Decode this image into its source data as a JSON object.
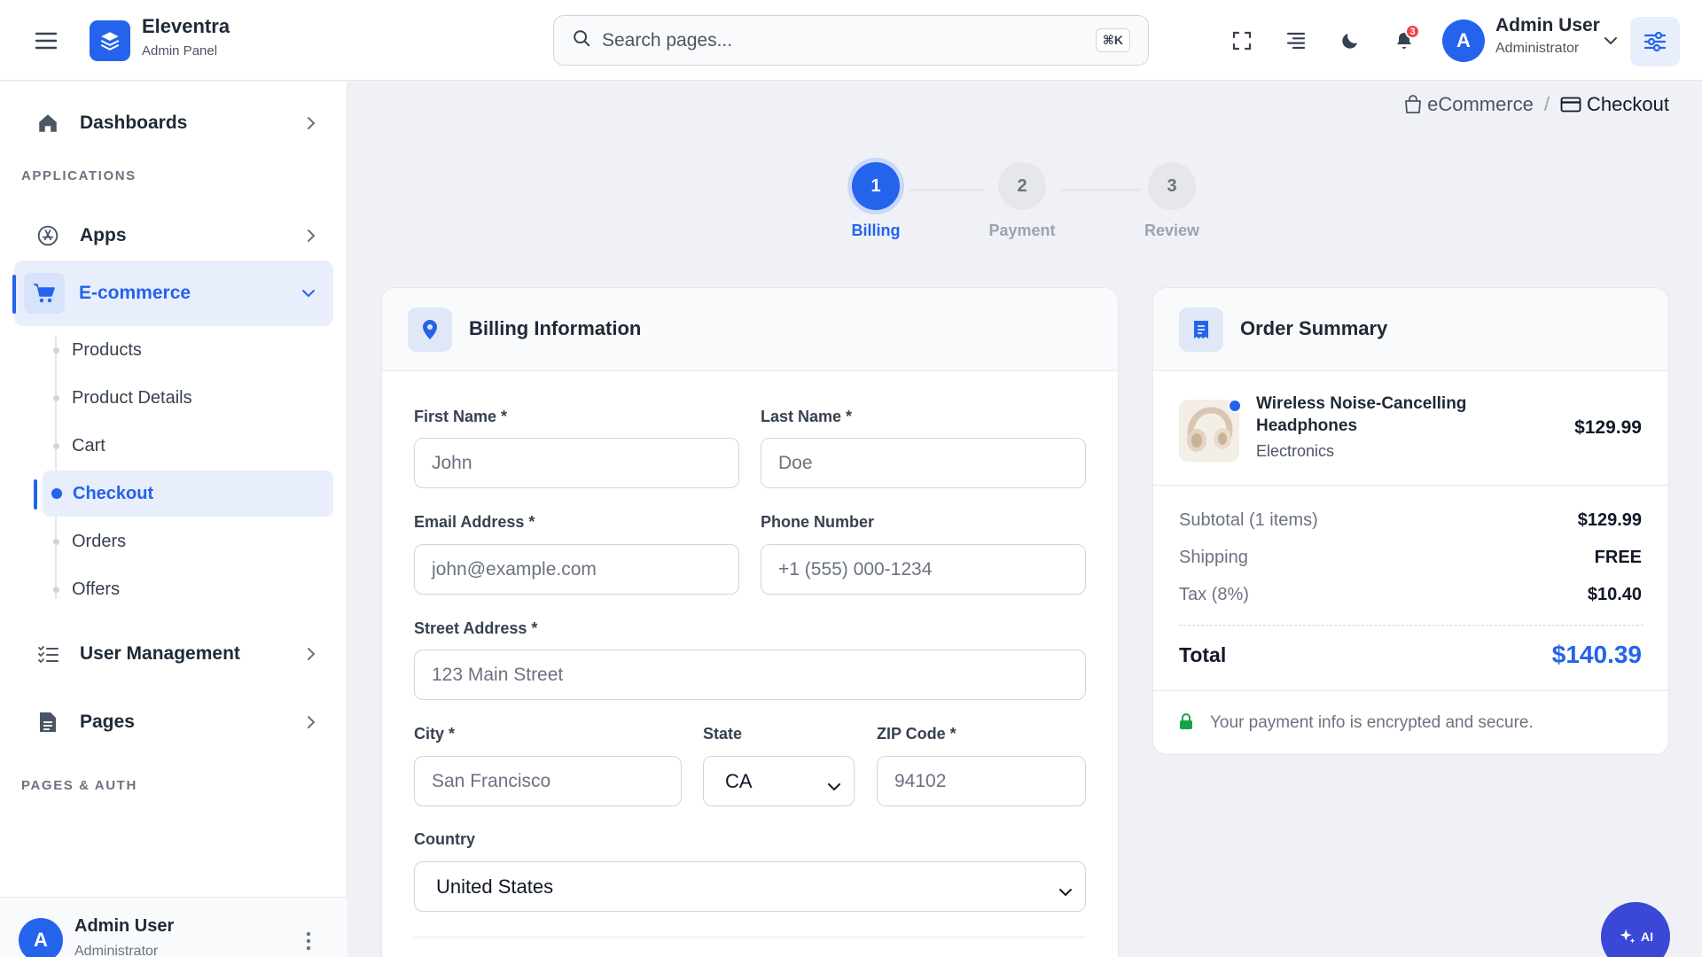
{
  "app": {
    "name": "Eleventra",
    "subtitle": "Admin Panel"
  },
  "search": {
    "placeholder": "Search pages...",
    "shortcut": "⌘K"
  },
  "header": {
    "notification_count": "3",
    "user": {
      "initial": "A",
      "name": "Admin User",
      "role": "Administrator"
    }
  },
  "sidebar": {
    "dashboards": "Dashboards",
    "section_applications": "APPLICATIONS",
    "apps": "Apps",
    "ecommerce": "E-commerce",
    "sub_items": [
      "Products",
      "Product Details",
      "Cart",
      "Checkout",
      "Orders",
      "Offers"
    ],
    "active_sub_item": "Checkout",
    "user_management": "User Management",
    "pages": "Pages",
    "section_pages_auth": "PAGES & AUTH",
    "footer_user": {
      "initial": "A",
      "name": "Admin User",
      "role": "Administrator"
    }
  },
  "breadcrumb": {
    "parent": "eCommerce",
    "separator": "/",
    "current": "Checkout"
  },
  "stepper": {
    "steps": [
      {
        "number": "1",
        "label": "Billing"
      },
      {
        "number": "2",
        "label": "Payment"
      },
      {
        "number": "3",
        "label": "Review"
      }
    ],
    "active_step": 1
  },
  "billing": {
    "title": "Billing Information",
    "first_name": {
      "label": "First Name *",
      "placeholder": "John"
    },
    "last_name": {
      "label": "Last Name *",
      "placeholder": "Doe"
    },
    "email": {
      "label": "Email Address *",
      "placeholder": "john@example.com"
    },
    "phone": {
      "label": "Phone Number",
      "placeholder": "+1 (555) 000-1234"
    },
    "street": {
      "label": "Street Address *",
      "placeholder": "123 Main Street"
    },
    "city": {
      "label": "City *",
      "placeholder": "San Francisco"
    },
    "state": {
      "label": "State",
      "value": "CA"
    },
    "zip": {
      "label": "ZIP Code *",
      "placeholder": "94102"
    },
    "country": {
      "label": "Country",
      "value": "United States"
    }
  },
  "order_summary": {
    "title": "Order Summary",
    "product": {
      "name": "Wireless Noise-Cancelling Headphones",
      "category": "Electronics",
      "price": "$129.99"
    },
    "subtotal_label": "Subtotal (1 items)",
    "subtotal_value": "$129.99",
    "shipping_label": "Shipping",
    "shipping_value": "FREE",
    "tax_label": "Tax (8%)",
    "tax_value": "$10.40",
    "total_label": "Total",
    "total_value": "$140.39",
    "secure_note": "Your payment info is encrypted and secure."
  },
  "ai_button": {
    "label": "AI"
  },
  "colors": {
    "accent": "#2463eb",
    "secure_green": "#16a34a",
    "notification_red": "#ef4444"
  }
}
